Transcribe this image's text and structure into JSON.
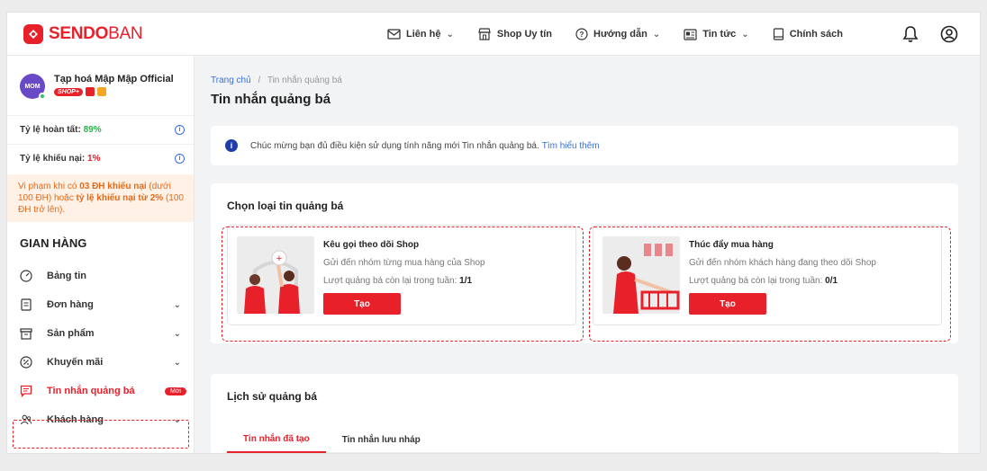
{
  "brand": {
    "name_bold": "SENDO",
    "name_light": "BAN",
    "color": "#e8202a"
  },
  "topnav": {
    "items": [
      {
        "label": "Liên hệ",
        "icon": "mail-icon",
        "has_dropdown": true
      },
      {
        "label": "Shop Uy tín",
        "icon": "store-icon",
        "has_dropdown": false
      },
      {
        "label": "Hướng dẫn",
        "icon": "help-circle-icon",
        "has_dropdown": true
      },
      {
        "label": "Tin tức",
        "icon": "news-icon",
        "has_dropdown": true
      },
      {
        "label": "Chính sách",
        "icon": "policy-icon",
        "has_dropdown": false
      }
    ],
    "dropdown_glyph": "⌄"
  },
  "sidebar": {
    "shop_name": "Tạp hoá Mập Mập Official",
    "avatar_text": "MOM",
    "shop_badge": "SHOP+",
    "stats": [
      {
        "label": "Tỷ lệ hoàn tất:",
        "value": "89%"
      },
      {
        "label": "Tỷ lệ khiếu nại:",
        "value": "1%"
      }
    ],
    "warning": {
      "part1": "Vi phạm khi có ",
      "bold1": "03 ĐH khiếu nại",
      "part2": " (dưới 100 ĐH) hoặc ",
      "bold2": "tỷ lệ khiếu nại từ 2%",
      "part3": " (100 ĐH trở lên)."
    },
    "section_title": "GIAN HÀNG",
    "menu": [
      {
        "label": "Bảng tin",
        "icon": "dashboard-icon",
        "has_chevron": false
      },
      {
        "label": "Đơn hàng",
        "icon": "order-icon",
        "has_chevron": true
      },
      {
        "label": "Sản phẩm",
        "icon": "product-icon",
        "has_chevron": true
      },
      {
        "label": "Khuyến mãi",
        "icon": "discount-icon",
        "has_chevron": true
      },
      {
        "label": "Tin nhắn quảng bá",
        "icon": "message-icon",
        "has_chevron": false,
        "badge": "Mới",
        "active": true
      },
      {
        "label": "Khách hàng",
        "icon": "customers-icon",
        "has_chevron": true
      }
    ]
  },
  "breadcrumb": {
    "home": "Trang chủ",
    "separator": "/",
    "current": "Tin nhắn quảng bá"
  },
  "page_title": "Tin nhắn quảng bá",
  "notice": {
    "text": "Chúc mừng bạn đủ điều kiện sử dụng tính năng mới Tin nhắn quảng bá.",
    "link": "Tìm hiểu thêm"
  },
  "choose_section": {
    "title": "Chọn loại tin quảng bá",
    "cards": [
      {
        "title": "Kêu gọi theo dõi Shop",
        "desc": "Gửi đến nhóm từng mua hàng của Shop",
        "quota_label": "Lượt quảng bá còn lại trong tuần:",
        "quota_value": "1/1",
        "button": "Tạo"
      },
      {
        "title": "Thúc đẩy mua hàng",
        "desc": "Gửi đến nhóm khách hàng đang theo dõi Shop",
        "quota_label": "Lượt quảng bá còn lại trong tuần:",
        "quota_value": "0/1",
        "button": "Tạo"
      }
    ]
  },
  "history": {
    "title": "Lịch sử quảng bá",
    "tabs": [
      {
        "label": "Tin nhắn đã tạo",
        "active": true
      },
      {
        "label": "Tin nhắn lưu nháp",
        "active": false
      }
    ]
  },
  "colors": {
    "accent": "#e8202a",
    "link": "#3b6fd8",
    "success": "#2bb24c",
    "warning_bg": "#fff1e6",
    "warning_text": "#e36a1a"
  }
}
